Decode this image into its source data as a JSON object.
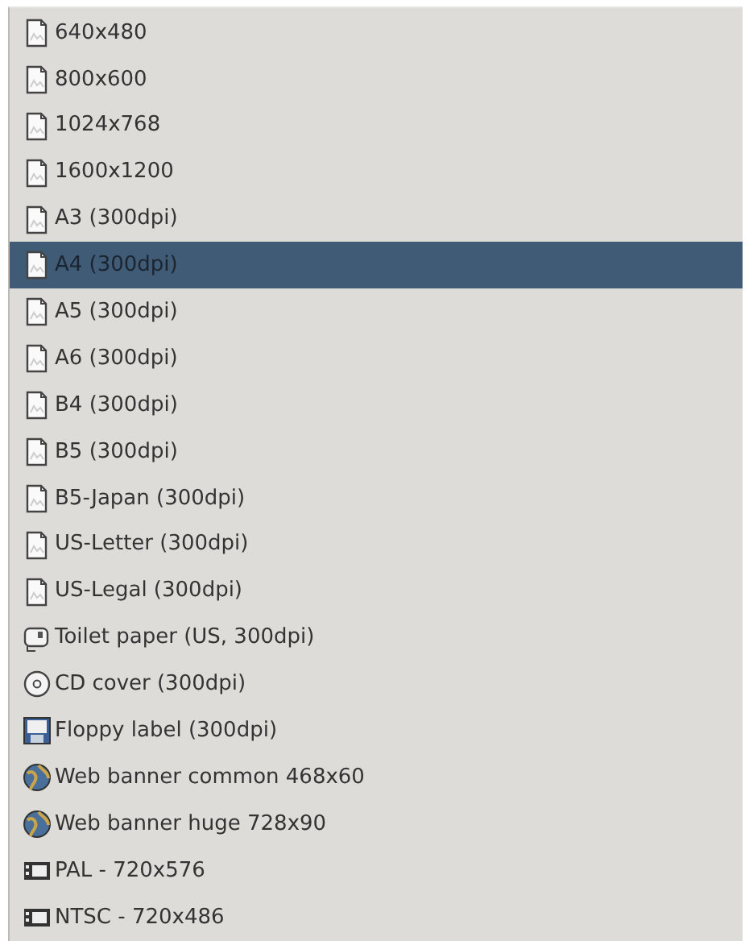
{
  "templates": [
    {
      "label": "640x480",
      "kind": "page",
      "selected": false
    },
    {
      "label": "800x600",
      "kind": "page",
      "selected": false
    },
    {
      "label": "1024x768",
      "kind": "page",
      "selected": false
    },
    {
      "label": "1600x1200",
      "kind": "page",
      "selected": false
    },
    {
      "label": "A3 (300dpi)",
      "kind": "page",
      "selected": false
    },
    {
      "label": "A4 (300dpi)",
      "kind": "page",
      "selected": true
    },
    {
      "label": "A5 (300dpi)",
      "kind": "page",
      "selected": false
    },
    {
      "label": "A6 (300dpi)",
      "kind": "page",
      "selected": false
    },
    {
      "label": "B4 (300dpi)",
      "kind": "page",
      "selected": false
    },
    {
      "label": "B5 (300dpi)",
      "kind": "page",
      "selected": false
    },
    {
      "label": "B5-Japan (300dpi)",
      "kind": "page",
      "selected": false
    },
    {
      "label": "US-Letter (300dpi)",
      "kind": "page",
      "selected": false
    },
    {
      "label": "US-Legal (300dpi)",
      "kind": "page",
      "selected": false
    },
    {
      "label": "Toilet paper (US, 300dpi)",
      "kind": "toilet",
      "selected": false
    },
    {
      "label": "CD cover (300dpi)",
      "kind": "cd",
      "selected": false
    },
    {
      "label": "Floppy label (300dpi)",
      "kind": "floppy",
      "selected": false
    },
    {
      "label": "Web banner common 468x60",
      "kind": "web",
      "selected": false
    },
    {
      "label": "Web banner huge 728x90",
      "kind": "web",
      "selected": false
    },
    {
      "label": "PAL - 720x576",
      "kind": "video",
      "selected": false
    },
    {
      "label": "NTSC - 720x486",
      "kind": "video",
      "selected": false
    }
  ]
}
